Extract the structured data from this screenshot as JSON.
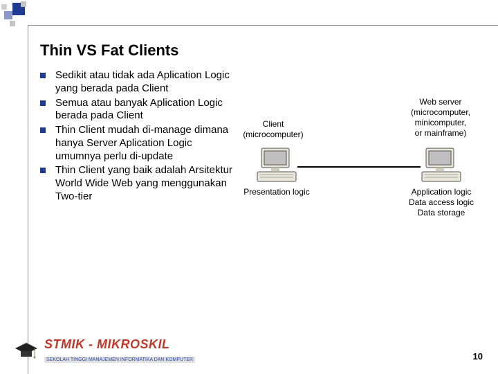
{
  "title": "Thin VS Fat Clients",
  "bullets": [
    "Sedikit atau tidak ada Aplication Logic yang berada pada Client",
    "Semua atau banyak Aplication Logic berada pada Client",
    "Thin Client mudah di-manage dimana hanya Server Aplication Logic umumnya perlu di-update",
    "Thin Client  yang baik adalah Arsitektur  World  Wide Web yang menggunakan Two-tier"
  ],
  "diagram": {
    "left": {
      "title": "Client",
      "subtitle": "(microcomputer)",
      "caption": "Presentation logic"
    },
    "right": {
      "title": "Web server",
      "subtitle1": "(microcomputer,",
      "subtitle2": "minicomputer,",
      "subtitle3": "or mainframe)",
      "caption1": "Application logic",
      "caption2": "Data access logic",
      "caption3": "Data storage"
    }
  },
  "brand": {
    "name": "STMIK - MIKROSKIL",
    "tagline": "SEKOLAH TINGGI MANAJEMEN INFORMATIKA DAN KOMPUTER"
  },
  "page_number": "10"
}
